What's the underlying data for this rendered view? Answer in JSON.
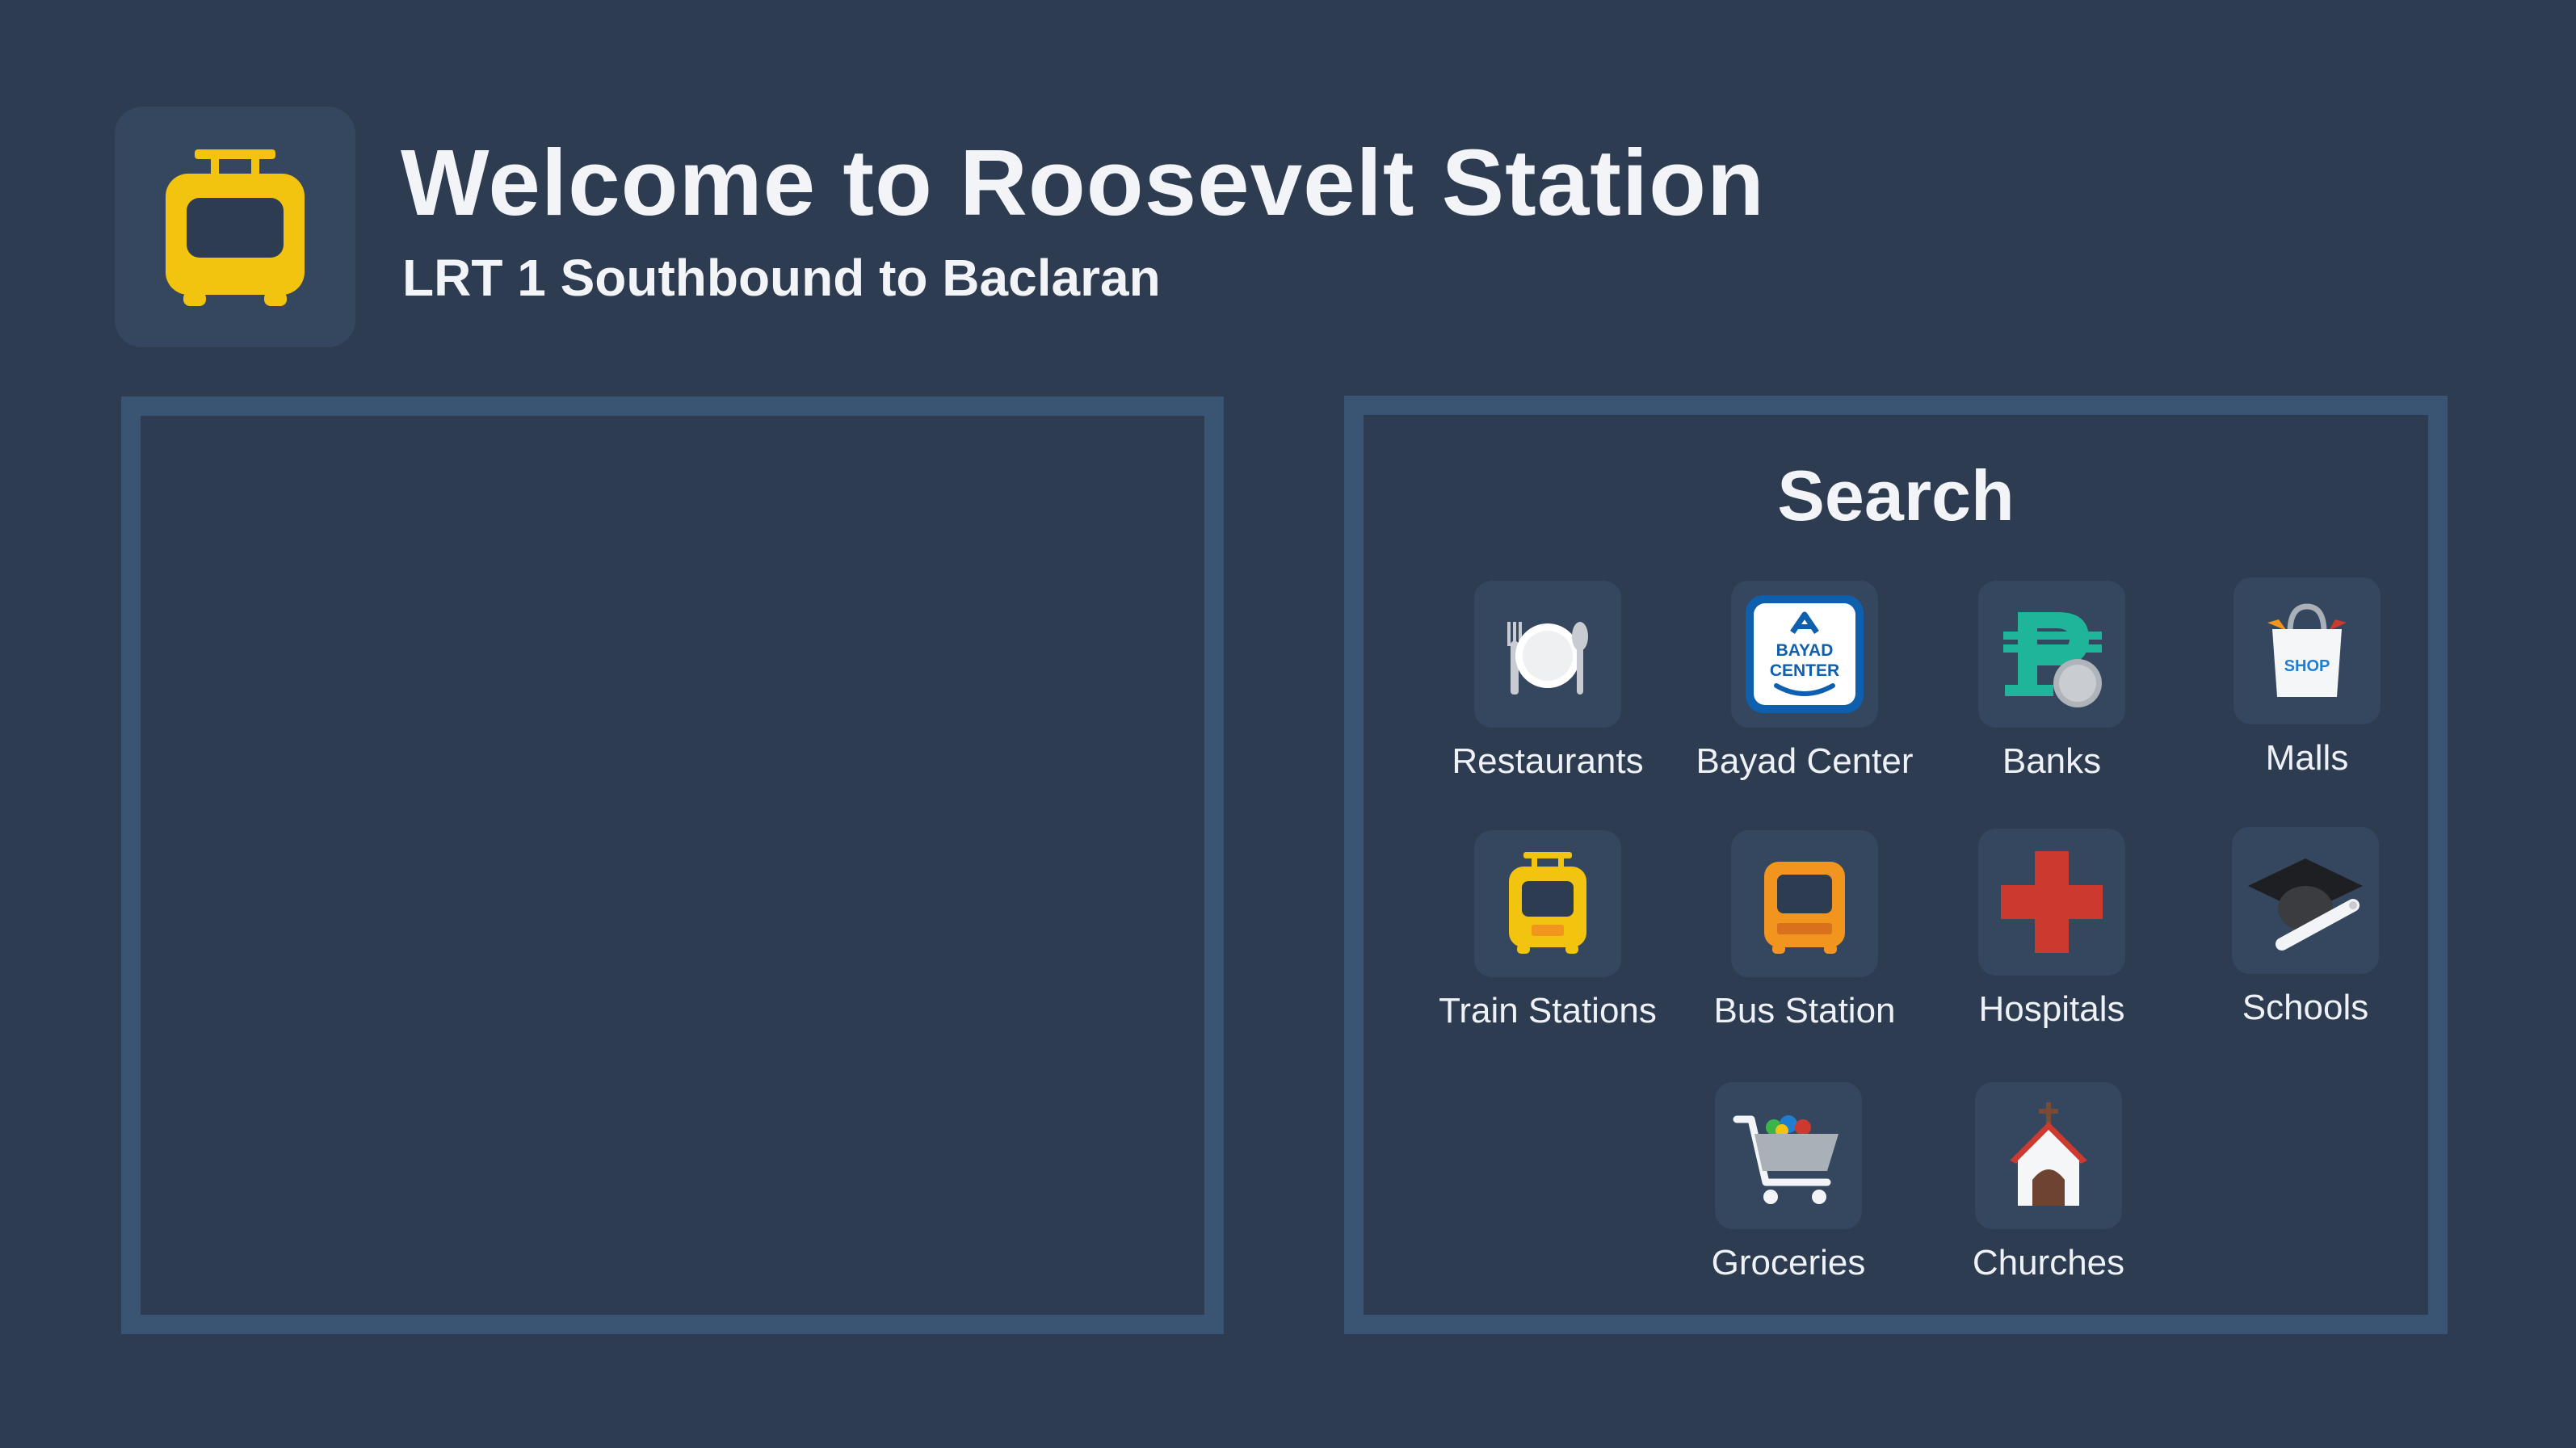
{
  "header": {
    "title": "Welcome to Roosevelt Station",
    "subtitle": "LRT 1 Southbound to Baclaran",
    "logo_icon": "train-icon"
  },
  "search": {
    "title": "Search",
    "categories": [
      {
        "label": "Restaurants",
        "icon": "restaurant-icon"
      },
      {
        "label": "Bayad Center",
        "icon": "bayad-center-icon",
        "icon_text": [
          "BAYAD",
          "CENTER"
        ]
      },
      {
        "label": "Banks",
        "icon": "peso-icon"
      },
      {
        "label": "Malls",
        "icon": "shopping-bag-icon",
        "icon_text": "SHOP"
      },
      {
        "label": "Train Stations",
        "icon": "train-icon"
      },
      {
        "label": "Bus Station",
        "icon": "bus-icon"
      },
      {
        "label": "Hospitals",
        "icon": "red-cross-icon"
      },
      {
        "label": "Schools",
        "icon": "graduation-cap-icon"
      },
      {
        "label": "Groceries",
        "icon": "shopping-cart-icon"
      },
      {
        "label": "Churches",
        "icon": "church-icon"
      }
    ]
  },
  "colors": {
    "background": "#2d3c50",
    "panel_border": "#3a5473",
    "tile": "#34475f",
    "train_yellow": "#f2c30f",
    "bus_orange": "#f2951e",
    "bank_teal": "#1fb59a",
    "hospital_red": "#cc3a2f"
  }
}
